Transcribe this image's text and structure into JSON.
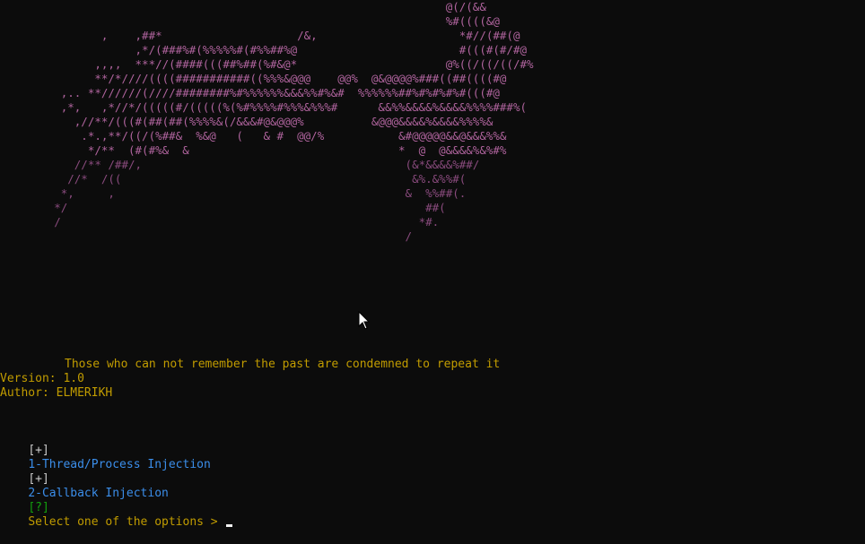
{
  "ascii_art": [
    "                                                                  @(/(&&",
    "                                                                  %#((((&@",
    "               ,    ,##*                    /&,                     *#//(##(@",
    "                    ,*/(###%#(%%%%%#(#%%##%@                        #(((#(#/#@",
    "              ,,,,  ***//(####(((##%##(%#&@*                      @%((/((/((/#%",
    "              **/*////((((###########((%%%&@@@    @@%  @&@@@@%###((##((((#@",
    "         ,.. **//////(////########%#%%%%%%&&&%%#%&#  %%%%%%##%#%#%#%#(((#@",
    "         ,*,   ,*//*/(((((#/(((((%(%#%%%%#%%%&%%%#      &&%%&&&&%&&&&%%%%###%(",
    "           ,//**/(((#(##(##(%%%%&(/&&&#@&@@@%          &@@@&&&&%&&&&%%%%&",
    "            .*.,**/((/(%##&  %&@   (   & #  @@/%           &#@@@@@&&@&&&%%&",
    "             */**  (#(#%&  &                               *  @  @&&&&%&%#%",
    "           //** /##/,                                       (&*&&&&%##/",
    "          //*  /((                                           &%.&%%#(",
    "         *,     ,                                           &  %%##(.",
    "        */                                                     ##(",
    "        /                                                     *#.",
    "                                                            /"
  ],
  "quote": "Those who can not remember the past are condemned to repeat it",
  "version_line": "Version: 1.0",
  "author_line": "Author: ELMERIKH",
  "menu": [
    {
      "bracket": "[+]",
      "label": "1-Thread/Process Injection"
    },
    {
      "bracket": "[+]",
      "label": "2-Callback Injection"
    }
  ],
  "prompt": {
    "bracket": "[?]",
    "text": "Select one of the options > "
  },
  "colors": {
    "background": "#0c0c0c",
    "art": "#b0649e",
    "yellow": "#c19c00",
    "blue": "#3b8eea",
    "green": "#13a10e"
  },
  "icons": {
    "pointer": "mouse-pointer-icon"
  }
}
